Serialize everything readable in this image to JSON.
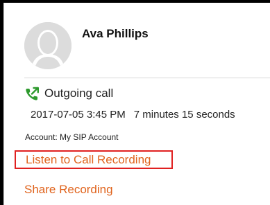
{
  "contact": {
    "name": "Ava Phillips",
    "avatar_icon": "person-silhouette-icon"
  },
  "call": {
    "icon": "outgoing-call-icon",
    "type": "Outgoing call",
    "datetime": "2017-07-05 3:45 PM",
    "duration": "7 minutes 15 seconds",
    "account": "Account: My SIP Account"
  },
  "actions": {
    "listen_label": "Listen to Call Recording",
    "share_label": "Share Recording"
  },
  "colors": {
    "link": "#e0631c",
    "highlight_border": "#e02020",
    "call_icon": "#2e9a2e"
  }
}
